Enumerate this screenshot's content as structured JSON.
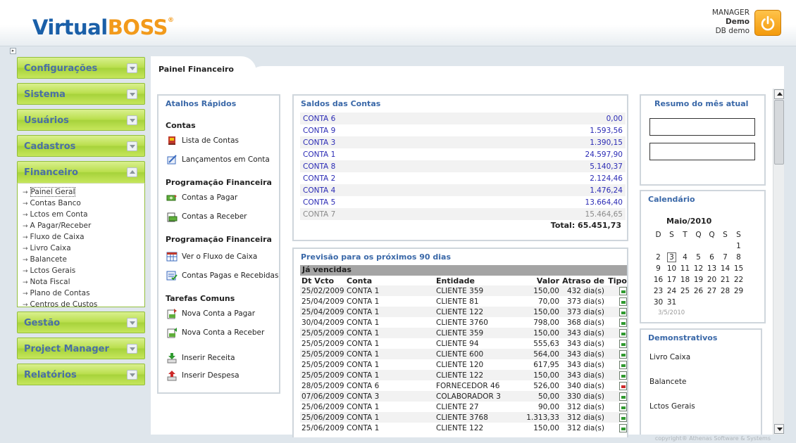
{
  "header": {
    "logo_part1": "Virtual",
    "logo_part2": "BOSS",
    "logo_reg": "®",
    "user_role": "MANAGER",
    "user_name": "Demo",
    "db_name": "DB demo",
    "power_icon": "power-icon"
  },
  "sidebar": {
    "menus": [
      {
        "label": "Configurações"
      },
      {
        "label": "Sistema"
      },
      {
        "label": "Usuários"
      },
      {
        "label": "Cadastros"
      },
      {
        "label": "Financeiro"
      },
      {
        "label": "Gestão"
      },
      {
        "label": "Project Manager"
      },
      {
        "label": "Relatórios"
      }
    ],
    "financeiro_items": [
      "Painel Geral",
      "Contas Banco",
      "Lctos em Conta",
      "A Pagar/Receber",
      "Fluxo de Caixa",
      "Livro Caixa",
      "Balancete",
      "Lctos Gerais",
      "Nota Fiscal",
      "Plano de Contas",
      "Centros de Custos"
    ]
  },
  "tab": {
    "label": "Painel Financeiro"
  },
  "atalhos": {
    "title": "Atalhos Rápidos",
    "sections": [
      {
        "title": "Contas",
        "items": [
          "Lista de Contas",
          "Lançamentos em Conta"
        ]
      },
      {
        "title": "Programação Financeira",
        "items": [
          "Contas a Pagar",
          "Contas a Receber"
        ]
      },
      {
        "title": "Programação Financeira",
        "items": [
          "Ver o Fluxo de Caixa",
          "Contas Pagas e Recebidas"
        ]
      },
      {
        "title": "Tarefas Comuns",
        "items": [
          "Nova Conta a Pagar",
          "Nova Conta a Receber",
          "Inserir Receita",
          "Inserir Despesa"
        ]
      }
    ]
  },
  "saldos": {
    "title": "Saldos das Contas",
    "rows": [
      {
        "conta": "CONTA 6",
        "valor": "0,00"
      },
      {
        "conta": "CONTA 9",
        "valor": "1.593,56"
      },
      {
        "conta": "CONTA 3",
        "valor": "1.390,15"
      },
      {
        "conta": "CONTA 1",
        "valor": "24.597,90"
      },
      {
        "conta": "CONTA 8",
        "valor": "5.140,37"
      },
      {
        "conta": "CONTA 2",
        "valor": "2.124,46"
      },
      {
        "conta": "CONTA 4",
        "valor": "1.476,24"
      },
      {
        "conta": "CONTA 5",
        "valor": "13.664,40"
      },
      {
        "conta": "CONTA 7",
        "valor": "15.464,65"
      }
    ],
    "total": "Total: 65.451,73"
  },
  "previsao": {
    "title": "Previsão para os próximos 90 dias",
    "group": "Já vencidas",
    "columns": [
      "Dt Vcto",
      "Conta",
      "Entidade",
      "Valor",
      "Atraso de",
      "Tipo"
    ],
    "rows": [
      [
        "25/02/2009",
        "CONTA 1",
        "CLIENTE 359",
        "150,00",
        "432 dia(s)",
        "receita"
      ],
      [
        "25/04/2009",
        "CONTA 1",
        "CLIENTE 81",
        "70,00",
        "373 dia(s)",
        "receita"
      ],
      [
        "25/04/2009",
        "CONTA 1",
        "CLIENTE 122",
        "150,00",
        "373 dia(s)",
        "receita"
      ],
      [
        "30/04/2009",
        "CONTA 1",
        "CLIENTE 3760",
        "798,00",
        "368 dia(s)",
        "receita"
      ],
      [
        "25/05/2009",
        "CONTA 1",
        "CLIENTE 359",
        "150,00",
        "343 dia(s)",
        "receita"
      ],
      [
        "25/05/2009",
        "CONTA 1",
        "CLIENTE 94",
        "555,63",
        "343 dia(s)",
        "receita"
      ],
      [
        "25/05/2009",
        "CONTA 1",
        "CLIENTE 600",
        "564,00",
        "343 dia(s)",
        "receita"
      ],
      [
        "25/05/2009",
        "CONTA 1",
        "CLIENTE 120",
        "617,95",
        "343 dia(s)",
        "receita"
      ],
      [
        "25/05/2009",
        "CONTA 1",
        "CLIENTE 122",
        "150,00",
        "343 dia(s)",
        "receita"
      ],
      [
        "28/05/2009",
        "CONTA 6",
        "FORNECEDOR 46",
        "526,00",
        "340 dia(s)",
        "despesa"
      ],
      [
        "07/06/2009",
        "CONTA 3",
        "COLABORADOR 3",
        "50,00",
        "330 dia(s)",
        "receita"
      ],
      [
        "25/06/2009",
        "CONTA 1",
        "CLIENTE 27",
        "90,00",
        "312 dia(s)",
        "receita"
      ],
      [
        "25/06/2009",
        "CONTA 1",
        "CLIENTE 3768",
        "1.313,33",
        "312 dia(s)",
        "receita"
      ],
      [
        "25/06/2009",
        "CONTA 1",
        "CLIENTE 122",
        "150,00",
        "312 dia(s)",
        "receita"
      ]
    ]
  },
  "resumo": {
    "title": "Resumo do mês atual"
  },
  "calendario": {
    "title": "Calendário",
    "month": "Maio/2010",
    "weekdays": [
      "D",
      "S",
      "T",
      "Q",
      "Q",
      "S",
      "S"
    ],
    "weeks": [
      [
        "",
        "",
        "",
        "",
        "",
        "",
        "1"
      ],
      [
        "2",
        "3",
        "4",
        "5",
        "6",
        "7",
        "8"
      ],
      [
        "9",
        "10",
        "11",
        "12",
        "13",
        "14",
        "15"
      ],
      [
        "16",
        "17",
        "18",
        "19",
        "20",
        "21",
        "22"
      ],
      [
        "23",
        "24",
        "25",
        "26",
        "27",
        "28",
        "29"
      ],
      [
        "30",
        "31",
        "",
        "",
        "",
        "",
        ""
      ]
    ],
    "today": "3",
    "footer_date": "3/5/2010"
  },
  "demonstrativos": {
    "title": "Demonstrativos",
    "items": [
      "Livro Caixa",
      "Balancete",
      "Lctos Gerais"
    ]
  },
  "copyright": "copyright® Athenas Software & Systems"
}
